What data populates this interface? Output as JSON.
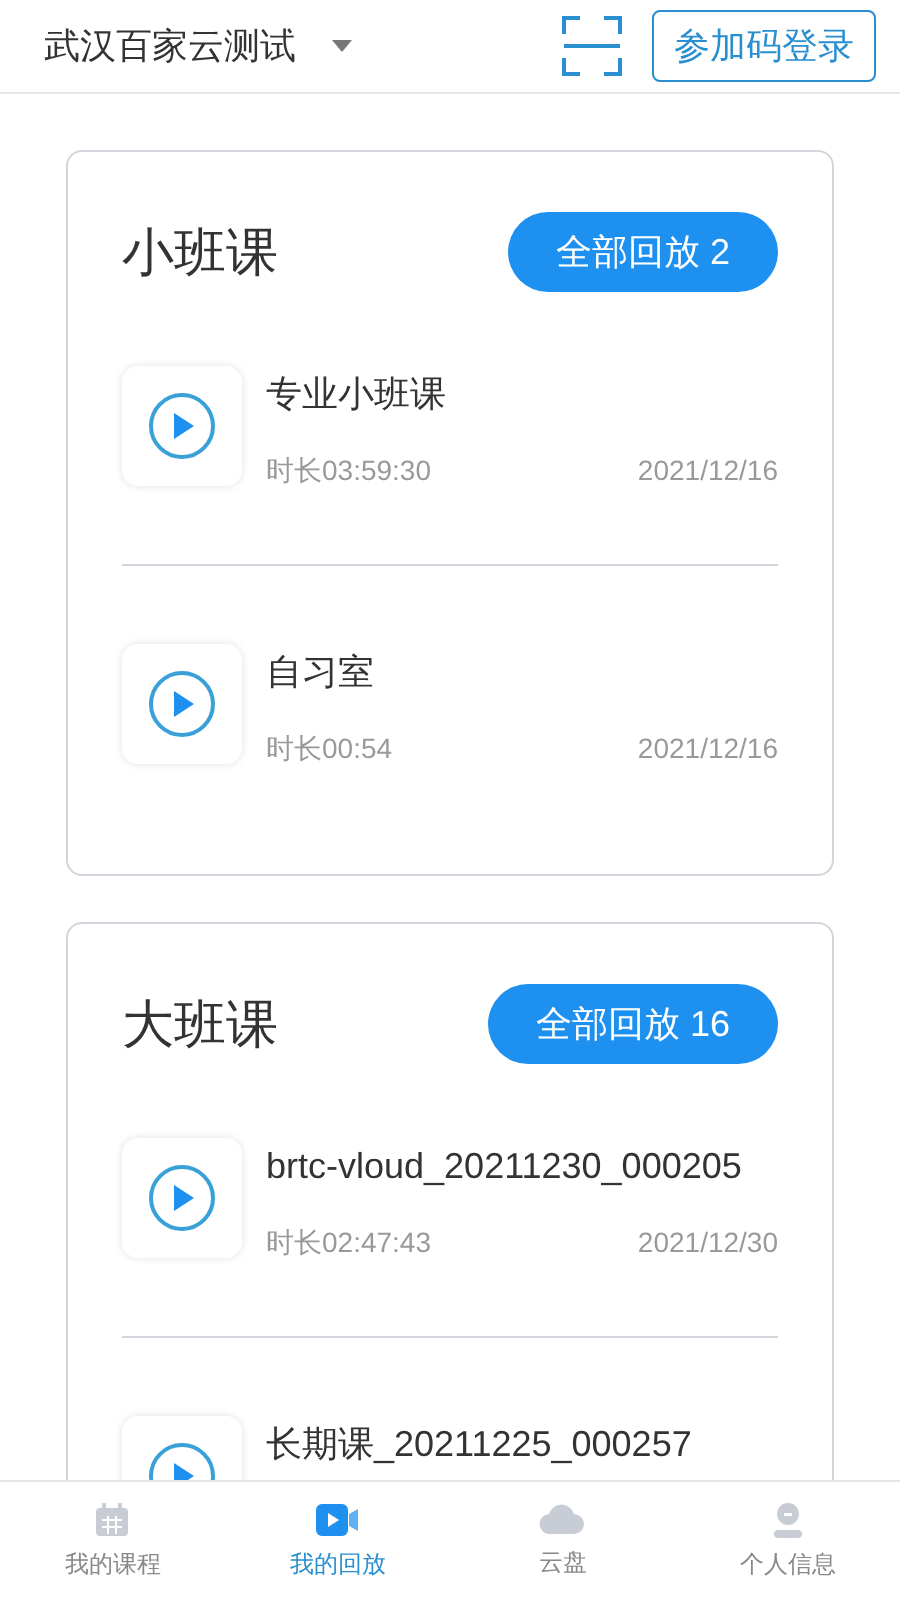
{
  "header": {
    "org": "武汉百家云测试",
    "login_button": "参加码登录"
  },
  "sections": [
    {
      "title": "小班课",
      "replay_button": "全部回放 2",
      "items": [
        {
          "title": "专业小班课",
          "duration": "时长03:59:30",
          "date": "2021/12/16"
        },
        {
          "title": "自习室",
          "duration": "时长00:54",
          "date": "2021/12/16"
        }
      ]
    },
    {
      "title": "大班课",
      "replay_button": "全部回放 16",
      "items": [
        {
          "title": "brtc-vloud_20211230_000205",
          "duration": "时长02:47:43",
          "date": "2021/12/30"
        },
        {
          "title": "长期课_20211225_000257"
        }
      ]
    }
  ],
  "tabs": [
    {
      "label": "我的课程",
      "kind": "calendar",
      "selected": false
    },
    {
      "label": "我的回放",
      "kind": "video",
      "selected": true
    },
    {
      "label": "云盘",
      "kind": "cloud",
      "selected": false
    },
    {
      "label": "个人信息",
      "kind": "person",
      "selected": false
    }
  ]
}
